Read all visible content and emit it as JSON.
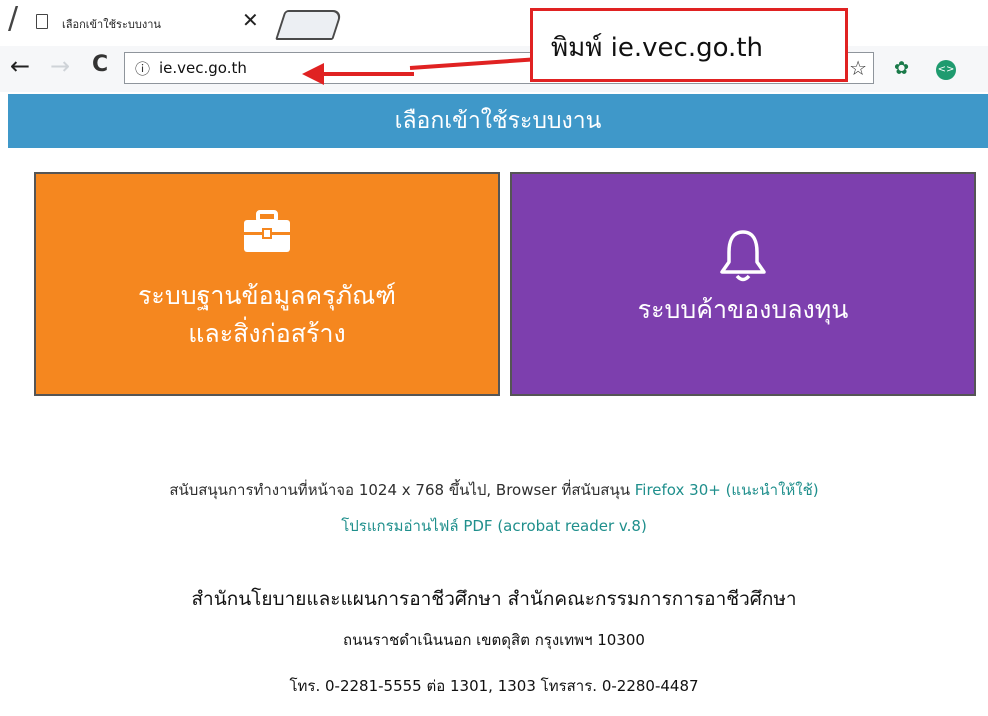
{
  "browser": {
    "tab_title": "เลือกเข้าใช้ระบบงาน",
    "tab_close": "✕",
    "url": "ie.vec.go.th"
  },
  "annotation": {
    "text": "พิมพ์  ie.vec.go.th",
    "color": "#e02222"
  },
  "page": {
    "header_title": "เลือกเข้าใช้ระบบงาน",
    "tiles": [
      {
        "label_line1": "ระบบฐานข้อมูลครุภัณฑ์",
        "label_line2": "และสิ่งก่อสร้าง",
        "icon": "briefcase-icon",
        "color": "#f5871f"
      },
      {
        "label_line1": "ระบบค้าของบลงทุน",
        "icon": "bell-icon",
        "color": "#7d3fae"
      }
    ],
    "support": {
      "line1_prefix": "สนับสนุนการทำงานที่หน้าจอ  1024  x  768  ขึ้นไป, Browser  ที่สนับสนุน ",
      "line1_teal": "Firefox  30+  (แนะนำให้ใช้)",
      "line2": "โปรแกรมอ่านไฟล์  PDF  (acrobat reader  v.8)"
    },
    "office": {
      "name": "สำนักนโยบายและแผนการอาชีวศึกษา  สำนักคณะกรรมการการอาชีวศึกษา",
      "address": "ถนนราชดำเนินนอก  เขตดุสิต  กรุงเทพฯ  10300",
      "phone": "โทร.  0-2281-5555  ต่อ  1301,  1303  โทรสาร.  0-2280-4487"
    },
    "header_color": "#3f98c9"
  }
}
